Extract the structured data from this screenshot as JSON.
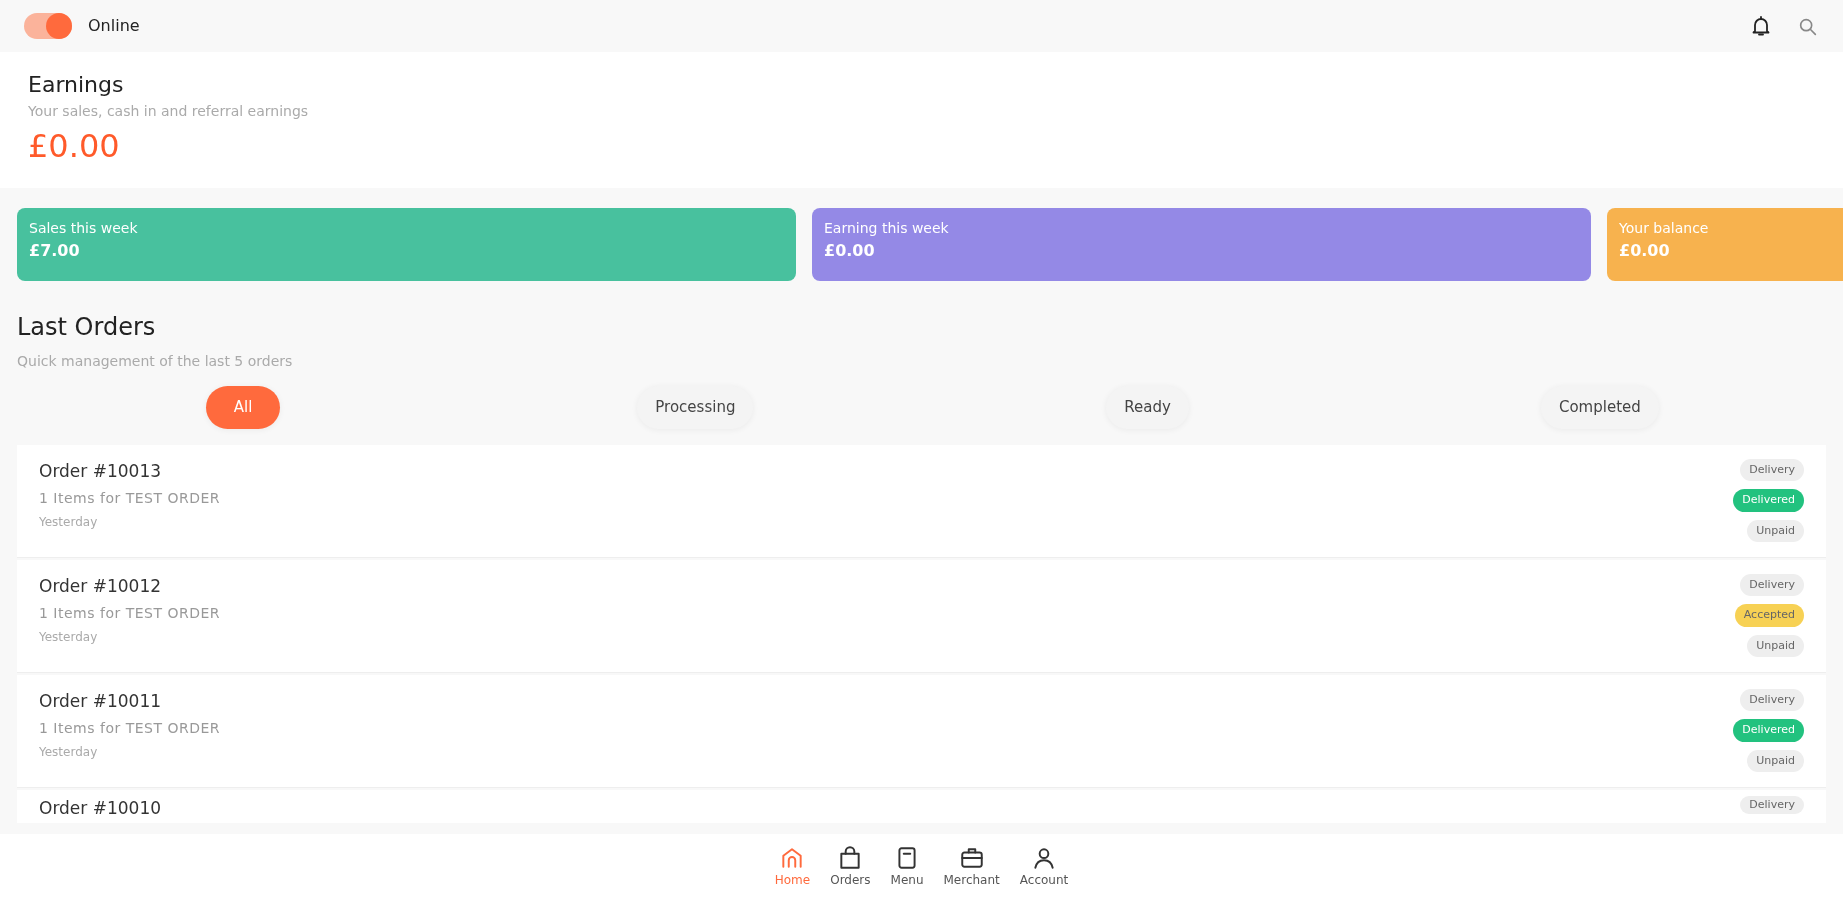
{
  "status_toggle": {
    "label": "Online",
    "on": true
  },
  "earnings": {
    "title": "Earnings",
    "subtitle": "Your sales, cash in and referral earnings",
    "amount": "£0.00"
  },
  "stats": [
    {
      "label": "Sales this week",
      "value": "£7.00",
      "color": "#48c19e"
    },
    {
      "label": "Earning this week",
      "value": "£0.00",
      "color": "#9489e6"
    },
    {
      "label": "Your balance",
      "value": "£0.00",
      "color": "#f7b24e"
    }
  ],
  "orders_section": {
    "title": "Last Orders",
    "subtitle": "Quick management of the last 5 orders"
  },
  "tabs": [
    {
      "label": "All",
      "selected": true
    },
    {
      "label": "Processing",
      "selected": false
    },
    {
      "label": "Ready",
      "selected": false
    },
    {
      "label": "Completed",
      "selected": false
    }
  ],
  "orders": [
    {
      "title": "Order #10013",
      "items": "1 Items for TEST ORDER",
      "time": "Yesterday",
      "tags": [
        {
          "text": "Delivery",
          "color": "#eeeeee"
        },
        {
          "text": "Delivered",
          "color": "#22c27f"
        },
        {
          "text": "Unpaid",
          "color": "#eeeeee"
        }
      ]
    },
    {
      "title": "Order #10012",
      "items": "1 Items for TEST ORDER",
      "time": "Yesterday",
      "tags": [
        {
          "text": "Delivery",
          "color": "#eeeeee"
        },
        {
          "text": "Accepted",
          "color": "#f7d154"
        },
        {
          "text": "Unpaid",
          "color": "#eeeeee"
        }
      ]
    },
    {
      "title": "Order #10011",
      "items": "1 Items for TEST ORDER",
      "time": "Yesterday",
      "tags": [
        {
          "text": "Delivery",
          "color": "#eeeeee"
        },
        {
          "text": "Delivered",
          "color": "#22c27f"
        },
        {
          "text": "Unpaid",
          "color": "#eeeeee"
        }
      ]
    },
    {
      "title": "Order #10010",
      "tags": [
        {
          "text": "Delivery",
          "color": "#eeeeee"
        }
      ]
    }
  ],
  "bottom_nav": [
    {
      "label": "Home",
      "selected": true
    },
    {
      "label": "Orders",
      "selected": false
    },
    {
      "label": "Menu",
      "selected": false
    },
    {
      "label": "Merchant",
      "selected": false
    },
    {
      "label": "Account",
      "selected": false
    }
  ]
}
